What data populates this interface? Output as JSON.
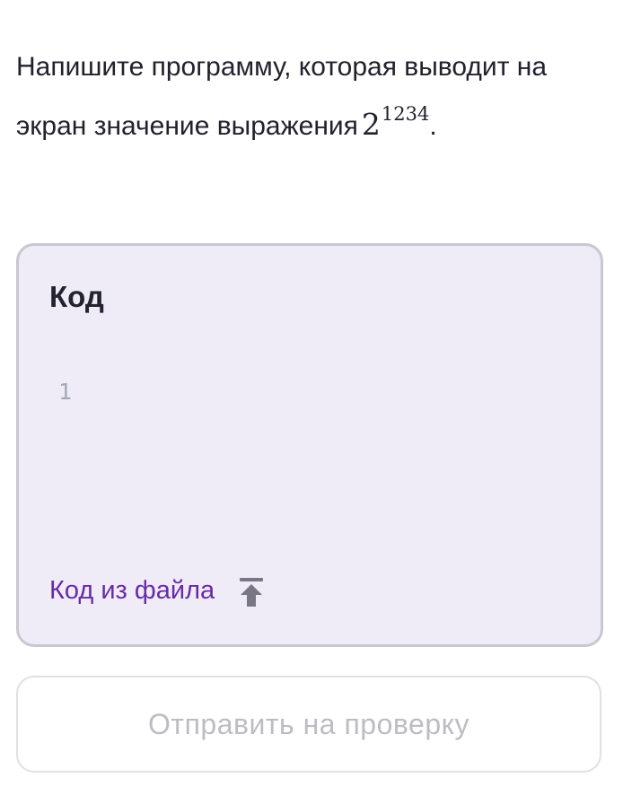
{
  "task": {
    "line1": "Напишите программу, которая выводит на",
    "line2": "экран значение выражения",
    "base": "2",
    "exponent": "1234",
    "end": "."
  },
  "code_panel": {
    "title": "Код",
    "line_number": "1",
    "file_label": "Код из файла",
    "file_icon": "upload-icon"
  },
  "submit": {
    "label": "Отправить на проверку",
    "disabled": true
  },
  "colors": {
    "panel_bg": "#efecf8",
    "panel_border": "#c9c7d0",
    "link": "#6a2aa8",
    "icon": "#7a7784",
    "disabled_text": "#bdbcc5"
  }
}
